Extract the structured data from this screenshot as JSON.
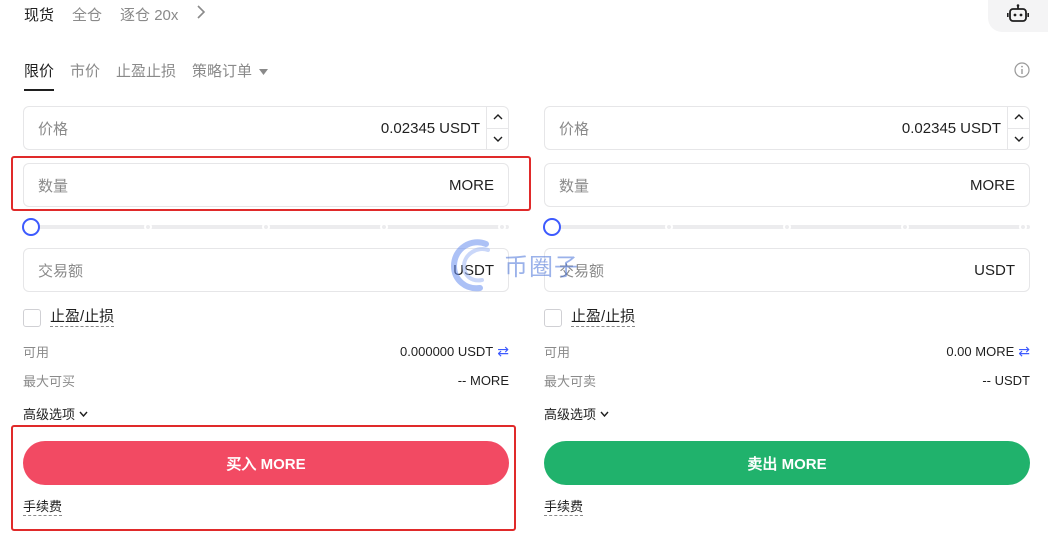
{
  "mode_tabs": {
    "spot": "现货",
    "cross": "全仓",
    "isolated": "逐仓 20x"
  },
  "order_tabs": {
    "limit": "限价",
    "market": "市价",
    "tpsl": "止盈止损",
    "strategy": "策略订单"
  },
  "buy": {
    "price_label": "价格",
    "price_value": "0.02345",
    "price_unit": "USDT",
    "amount_label": "数量",
    "amount_unit": "MORE",
    "total_label": "交易额",
    "total_unit": "USDT",
    "tpsl_label": "止盈/止损",
    "available_label": "可用",
    "available_value": "0.000000 USDT",
    "max_label": "最大可买",
    "max_value": "-- MORE",
    "advanced_label": "高级选项",
    "button_label": "买入 MORE",
    "fee_label": "手续费"
  },
  "sell": {
    "price_label": "价格",
    "price_value": "0.02345",
    "price_unit": "USDT",
    "amount_label": "数量",
    "amount_unit": "MORE",
    "total_label": "交易额",
    "total_unit": "USDT",
    "tpsl_label": "止盈/止损",
    "available_label": "可用",
    "available_value": "0.00 MORE",
    "max_label": "最大可卖",
    "max_value": "-- USDT",
    "advanced_label": "高级选项",
    "button_label": "卖出 MORE",
    "fee_label": "手续费"
  },
  "slider": {
    "value": 0
  },
  "watermark": {
    "text": "币圈子"
  },
  "colors": {
    "buy": "#f24a63",
    "sell": "#20b26c",
    "accent": "#3d5afe",
    "highlight": "#e02a2a"
  },
  "icons": {
    "robot": "robot-icon",
    "info": "info-icon",
    "chevron": "chevron-right-icon",
    "dropdown": "caret-down-icon",
    "swap": "swap-icon"
  }
}
